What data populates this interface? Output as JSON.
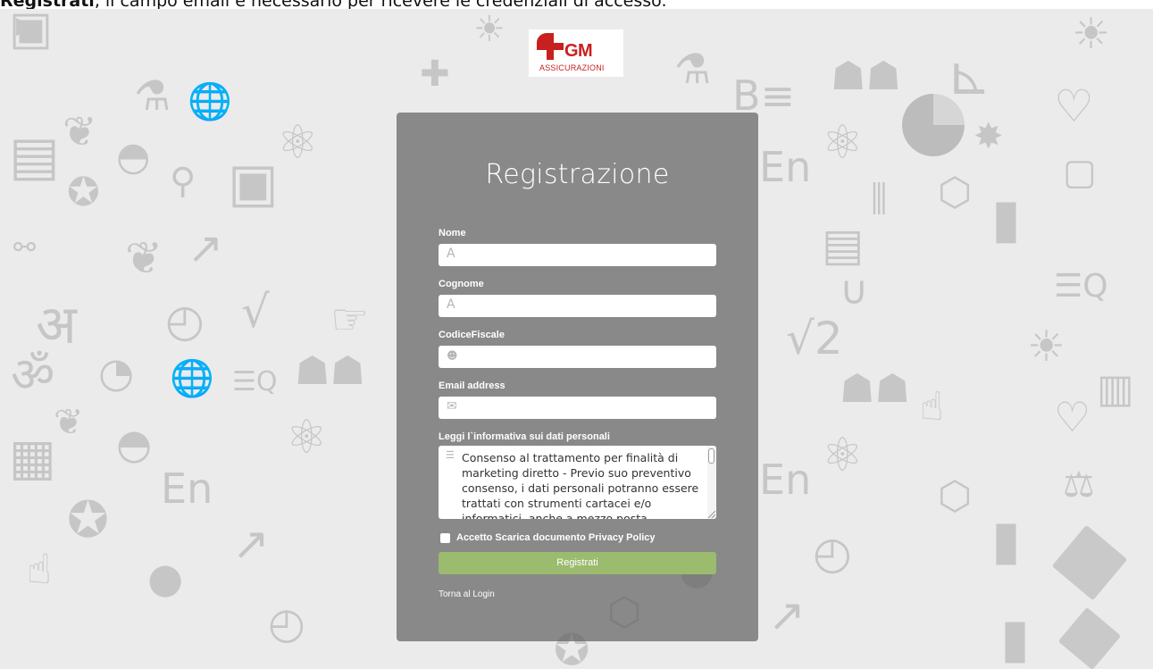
{
  "instruction": {
    "bold": "Registrati",
    "rest": ", il campo email è necessario per ricevere le credenziali di accesso."
  },
  "logo": {
    "mark": "GM",
    "subtitle": "ASSICURAZIONI"
  },
  "form": {
    "title": "Registrazione",
    "fields": [
      {
        "label": "Nome",
        "icon": "letter-a-icon",
        "glyph": "A",
        "value": ""
      },
      {
        "label": "Cognome",
        "icon": "letter-a-icon",
        "glyph": "A",
        "value": ""
      },
      {
        "label": "CodiceFiscale",
        "icon": "user-icon",
        "glyph": "👤",
        "value": ""
      },
      {
        "label": "Email address",
        "icon": "envelope-icon",
        "glyph": "✉",
        "value": ""
      }
    ],
    "privacy_label": "Leggi l`informativa sui dati personali",
    "privacy_text": "Consenso al trattamento per finalità di marketing diretto - Previo suo preventivo consenso, i dati personali potranno essere trattati con strumenti cartacei e/o informatici, anche a mezzo posta elettronica o di telefono...",
    "accept_label": "Accetto Scarica documento Privacy Policy",
    "accept_checked": false,
    "submit_label": "Registrati",
    "back_link": "Torna al Login"
  },
  "colors": {
    "brand": "#c8201f",
    "button": "#9bbb6e",
    "panel": "#606060"
  }
}
